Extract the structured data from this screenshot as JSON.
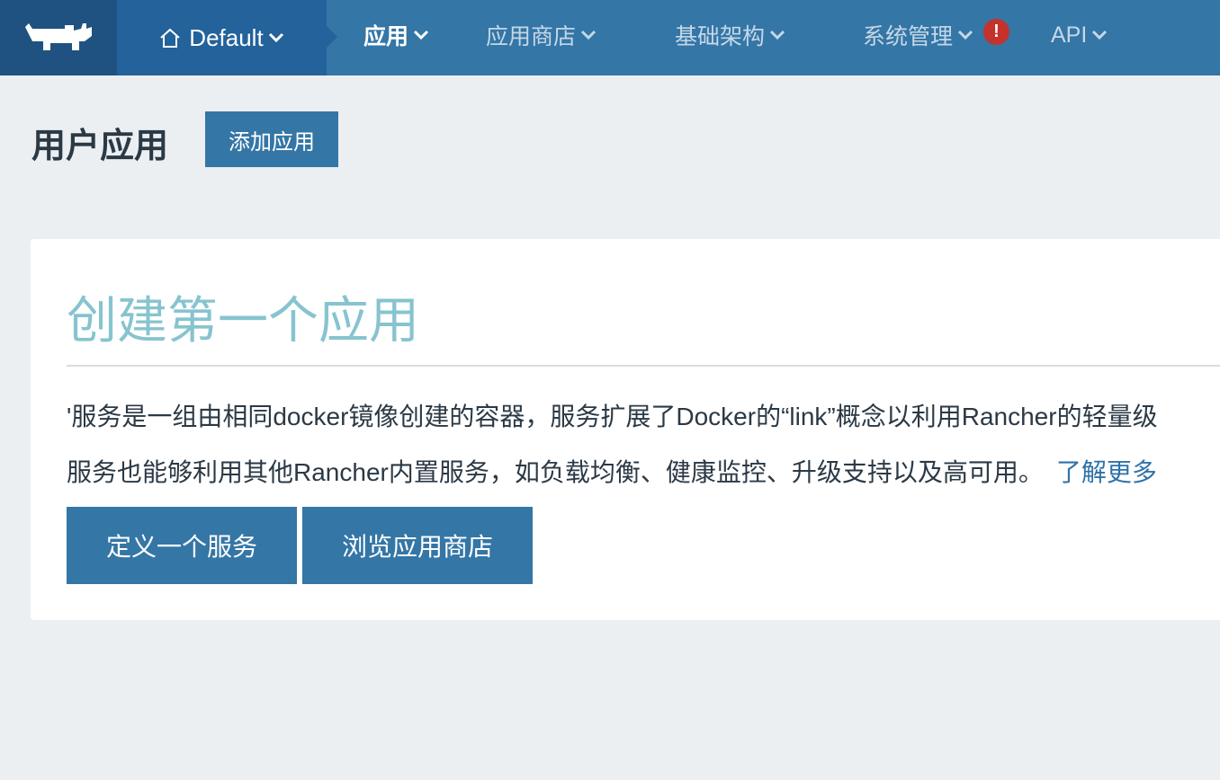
{
  "nav": {
    "environment": "Default",
    "items": [
      {
        "label": "应用"
      },
      {
        "label": "应用商店"
      },
      {
        "label": "基础架构"
      },
      {
        "label": "系统管理"
      },
      {
        "label": "API"
      }
    ],
    "alert_glyph": "!"
  },
  "page": {
    "title": "用户应用",
    "add_button": "添加应用"
  },
  "empty_state": {
    "heading": "创建第一个应用",
    "line1": "'服务是一组由相同docker镜像创建的容器，服务扩展了Docker的“link”概念以利用Rancher的轻量级",
    "line2": "服务也能够利用其他Rancher内置服务，如负载均衡、健康监控、升级支持以及高可用。",
    "learn_more": "了解更多",
    "define_service_button": "定义一个服务",
    "browse_catalog_button": "浏览应用商店"
  },
  "colors": {
    "nav_bg": "#3476a6",
    "logo_bg": "#1f5281",
    "env_bg": "#23629a",
    "accent": "#3476a6",
    "heading": "#86c4cf",
    "alert": "#c4322b"
  },
  "icons": [
    "rancher-logo-icon",
    "home-icon",
    "chevron-down-icon",
    "alert-icon"
  ]
}
